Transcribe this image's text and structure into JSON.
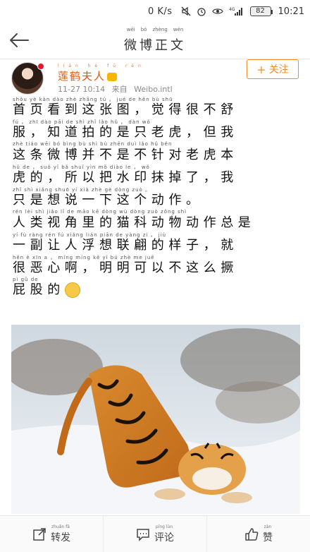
{
  "status_bar": {
    "net_speed": "0 K/s",
    "signal_label": "4G",
    "battery": "82",
    "time": "10:21"
  },
  "header": {
    "title": "微博正文",
    "title_pinyin": [
      "wēi",
      "bó",
      "zhèng",
      "wén"
    ]
  },
  "author": {
    "name": "莲鹤夫人",
    "name_pinyin": "lián hè fū rén",
    "time": "11-27 10:14",
    "source_label": "来自",
    "source": "Weibo.intl",
    "follow_label": "关注"
  },
  "post": {
    "lines": [
      {
        "py": "shǒu yè kàn dào zhè zhāng tú ， jué de hěn bù shū",
        "text": "首页看到这张图，觉得很不舒"
      },
      {
        "py": "fú ， zhī dào pāi de shì zhǐ lǎo hǔ ， dàn wǒ",
        "text": "服，知道拍的是只老虎，但我"
      },
      {
        "py": "zhè tiáo wēi bó bìng bù shì bù zhēn duì lǎo hǔ běn",
        "text": "这条微博并不是不针对老虎本"
      },
      {
        "py": "hǔ de ， suǒ yǐ bǎ shuǐ yìn mǒ diào le ， wǒ",
        "text": "虎的，所以把水印抹掉了，我"
      },
      {
        "py": "zhǐ shì xiǎng shuō yí xià zhè gè dòng zuò 。",
        "text": "只是想说一下这个动作。"
      },
      {
        "py": "rén lèi shì jiǎo lǐ de māo kē dòng wù dòng zuò zǒng shì",
        "text": "人类视角里的猫科动物动作总是"
      },
      {
        "py": "yí fù ràng rén fú xiǎng lián piān de yàng zi ， jiù",
        "text": "一副让人浮想联翩的样子，就"
      },
      {
        "py": "hěn è xīn a ， míng míng kě yǐ bú zhè me juē",
        "text": "很恶心啊，明明可以不这么撅"
      },
      {
        "py": "pì gǔ de",
        "text": "屁股的"
      }
    ]
  },
  "actions": {
    "repost_label": "转发",
    "repost_pinyin": "zhuǎn fā",
    "comment_label": "评论",
    "comment_pinyin": "píng lùn",
    "like_label": "赞",
    "like_pinyin": "zàn"
  },
  "icons": {
    "back": "back-arrow-icon",
    "repost": "repost-icon",
    "comment": "comment-icon",
    "like": "thumbs-up-icon"
  },
  "colors": {
    "accent": "#f28c28",
    "username": "#e05a10"
  }
}
